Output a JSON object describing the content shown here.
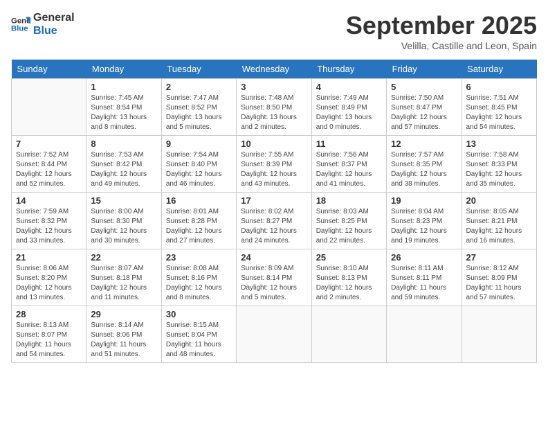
{
  "header": {
    "logo_line1": "General",
    "logo_line2": "Blue",
    "month": "September 2025",
    "location": "Velilla, Castille and Leon, Spain"
  },
  "weekdays": [
    "Sunday",
    "Monday",
    "Tuesday",
    "Wednesday",
    "Thursday",
    "Friday",
    "Saturday"
  ],
  "weeks": [
    [
      {
        "day": "",
        "info": ""
      },
      {
        "day": "1",
        "info": "Sunrise: 7:45 AM\nSunset: 8:54 PM\nDaylight: 13 hours\nand 8 minutes."
      },
      {
        "day": "2",
        "info": "Sunrise: 7:47 AM\nSunset: 8:52 PM\nDaylight: 13 hours\nand 5 minutes."
      },
      {
        "day": "3",
        "info": "Sunrise: 7:48 AM\nSunset: 8:50 PM\nDaylight: 13 hours\nand 2 minutes."
      },
      {
        "day": "4",
        "info": "Sunrise: 7:49 AM\nSunset: 8:49 PM\nDaylight: 13 hours\nand 0 minutes."
      },
      {
        "day": "5",
        "info": "Sunrise: 7:50 AM\nSunset: 8:47 PM\nDaylight: 12 hours\nand 57 minutes."
      },
      {
        "day": "6",
        "info": "Sunrise: 7:51 AM\nSunset: 8:45 PM\nDaylight: 12 hours\nand 54 minutes."
      }
    ],
    [
      {
        "day": "7",
        "info": "Sunrise: 7:52 AM\nSunset: 8:44 PM\nDaylight: 12 hours\nand 52 minutes."
      },
      {
        "day": "8",
        "info": "Sunrise: 7:53 AM\nSunset: 8:42 PM\nDaylight: 12 hours\nand 49 minutes."
      },
      {
        "day": "9",
        "info": "Sunrise: 7:54 AM\nSunset: 8:40 PM\nDaylight: 12 hours\nand 46 minutes."
      },
      {
        "day": "10",
        "info": "Sunrise: 7:55 AM\nSunset: 8:39 PM\nDaylight: 12 hours\nand 43 minutes."
      },
      {
        "day": "11",
        "info": "Sunrise: 7:56 AM\nSunset: 8:37 PM\nDaylight: 12 hours\nand 41 minutes."
      },
      {
        "day": "12",
        "info": "Sunrise: 7:57 AM\nSunset: 8:35 PM\nDaylight: 12 hours\nand 38 minutes."
      },
      {
        "day": "13",
        "info": "Sunrise: 7:58 AM\nSunset: 8:33 PM\nDaylight: 12 hours\nand 35 minutes."
      }
    ],
    [
      {
        "day": "14",
        "info": "Sunrise: 7:59 AM\nSunset: 8:32 PM\nDaylight: 12 hours\nand 33 minutes."
      },
      {
        "day": "15",
        "info": "Sunrise: 8:00 AM\nSunset: 8:30 PM\nDaylight: 12 hours\nand 30 minutes."
      },
      {
        "day": "16",
        "info": "Sunrise: 8:01 AM\nSunset: 8:28 PM\nDaylight: 12 hours\nand 27 minutes."
      },
      {
        "day": "17",
        "info": "Sunrise: 8:02 AM\nSunset: 8:27 PM\nDaylight: 12 hours\nand 24 minutes."
      },
      {
        "day": "18",
        "info": "Sunrise: 8:03 AM\nSunset: 8:25 PM\nDaylight: 12 hours\nand 22 minutes."
      },
      {
        "day": "19",
        "info": "Sunrise: 8:04 AM\nSunset: 8:23 PM\nDaylight: 12 hours\nand 19 minutes."
      },
      {
        "day": "20",
        "info": "Sunrise: 8:05 AM\nSunset: 8:21 PM\nDaylight: 12 hours\nand 16 minutes."
      }
    ],
    [
      {
        "day": "21",
        "info": "Sunrise: 8:06 AM\nSunset: 8:20 PM\nDaylight: 12 hours\nand 13 minutes."
      },
      {
        "day": "22",
        "info": "Sunrise: 8:07 AM\nSunset: 8:18 PM\nDaylight: 12 hours\nand 11 minutes."
      },
      {
        "day": "23",
        "info": "Sunrise: 8:08 AM\nSunset: 8:16 PM\nDaylight: 12 hours\nand 8 minutes."
      },
      {
        "day": "24",
        "info": "Sunrise: 8:09 AM\nSunset: 8:14 PM\nDaylight: 12 hours\nand 5 minutes."
      },
      {
        "day": "25",
        "info": "Sunrise: 8:10 AM\nSunset: 8:13 PM\nDaylight: 12 hours\nand 2 minutes."
      },
      {
        "day": "26",
        "info": "Sunrise: 8:11 AM\nSunset: 8:11 PM\nDaylight: 11 hours\nand 59 minutes."
      },
      {
        "day": "27",
        "info": "Sunrise: 8:12 AM\nSunset: 8:09 PM\nDaylight: 11 hours\nand 57 minutes."
      }
    ],
    [
      {
        "day": "28",
        "info": "Sunrise: 8:13 AM\nSunset: 8:07 PM\nDaylight: 11 hours\nand 54 minutes."
      },
      {
        "day": "29",
        "info": "Sunrise: 8:14 AM\nSunset: 8:06 PM\nDaylight: 11 hours\nand 51 minutes."
      },
      {
        "day": "30",
        "info": "Sunrise: 8:15 AM\nSunset: 8:04 PM\nDaylight: 11 hours\nand 48 minutes."
      },
      {
        "day": "",
        "info": ""
      },
      {
        "day": "",
        "info": ""
      },
      {
        "day": "",
        "info": ""
      },
      {
        "day": "",
        "info": ""
      }
    ]
  ]
}
